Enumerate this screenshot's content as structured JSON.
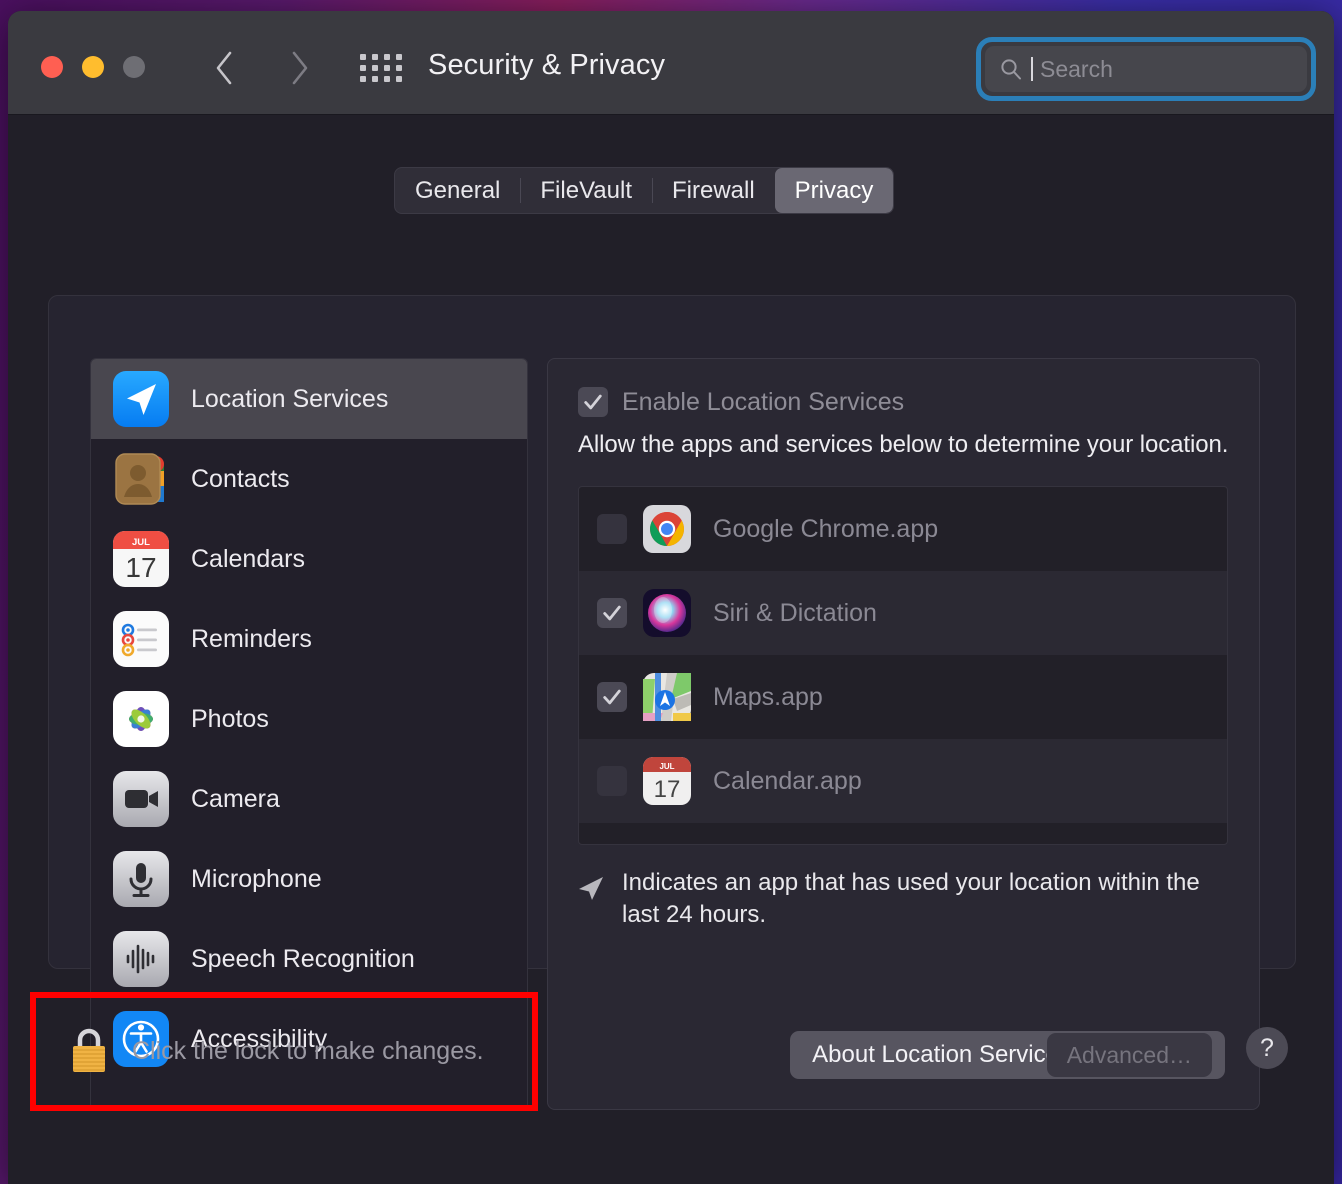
{
  "window": {
    "title": "Security & Privacy",
    "traffic_lights": [
      "close",
      "minimize",
      "zoom"
    ],
    "nav": {
      "back_icon": "chevron-left-icon",
      "forward_icon": "chevron-right-icon",
      "grid_icon": "grid-view-all-icon"
    }
  },
  "search": {
    "placeholder": "Search",
    "value": "",
    "icon": "search-icon",
    "focus_ring_color": "#2b7fb8",
    "focused": true
  },
  "tabs": [
    {
      "label": "General",
      "selected": false
    },
    {
      "label": "FileVault",
      "selected": false
    },
    {
      "label": "Firewall",
      "selected": false
    },
    {
      "label": "Privacy",
      "selected": true
    }
  ],
  "sidebar": {
    "items": [
      {
        "label": "Location Services",
        "icon": "location-arrow-icon",
        "selected": true
      },
      {
        "label": "Contacts",
        "icon": "contacts-icon",
        "selected": false
      },
      {
        "label": "Calendars",
        "icon": "calendar-icon",
        "selected": false
      },
      {
        "label": "Reminders",
        "icon": "reminders-icon",
        "selected": false
      },
      {
        "label": "Photos",
        "icon": "photos-icon",
        "selected": false
      },
      {
        "label": "Camera",
        "icon": "camera-icon",
        "selected": false
      },
      {
        "label": "Microphone",
        "icon": "microphone-icon",
        "selected": false
      },
      {
        "label": "Speech Recognition",
        "icon": "waveform-icon",
        "selected": false
      },
      {
        "label": "Accessibility",
        "icon": "accessibility-icon",
        "selected": false
      }
    ]
  },
  "detail": {
    "enable_checkbox": {
      "label": "Enable Location Services",
      "checked": true,
      "disabled": true
    },
    "description": "Allow the apps and services below to determine your location.",
    "apps": [
      {
        "name": "Google Chrome.app",
        "checked": false,
        "icon": "chrome-icon"
      },
      {
        "name": "Siri & Dictation",
        "checked": true,
        "icon": "siri-icon"
      },
      {
        "name": "Maps.app",
        "checked": true,
        "icon": "maps-icon"
      },
      {
        "name": "Calendar.app",
        "checked": false,
        "icon": "calendar-icon"
      }
    ],
    "note": {
      "icon": "location-arrow-indicator-icon",
      "text": "Indicates an app that has used your location within the last 24 hours."
    },
    "about_button": "About Location Services & Privacy…"
  },
  "footer": {
    "lock": {
      "icon": "lock-closed-icon",
      "text": "Click the lock to make changes."
    },
    "advanced_button": "Advanced…",
    "help_button": "?",
    "highlight_color": "#ff0000"
  }
}
